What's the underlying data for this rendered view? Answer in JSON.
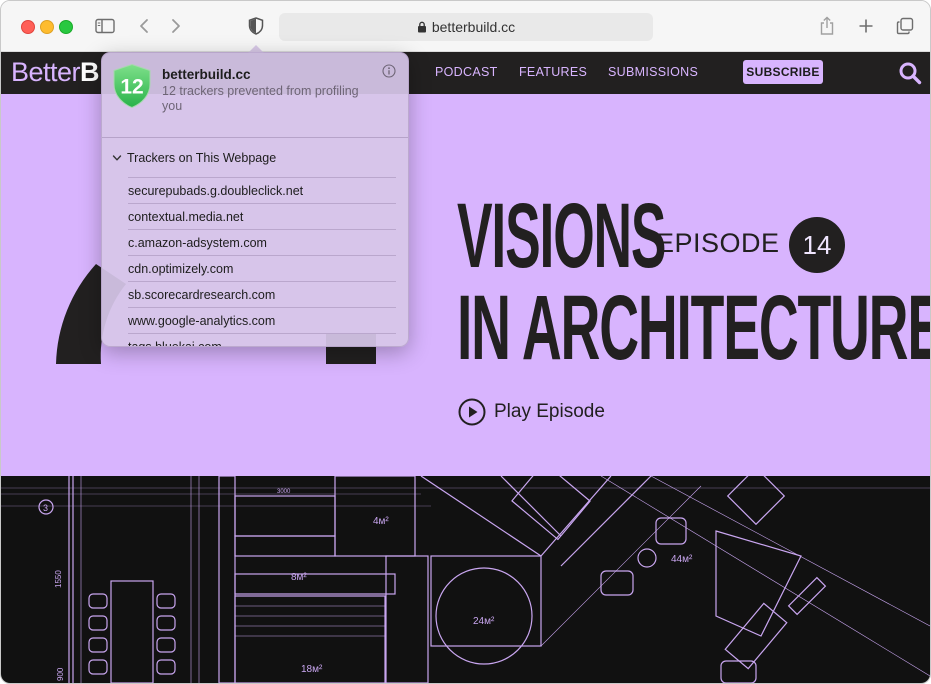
{
  "browser": {
    "url": "betterbuild.cc",
    "icons": [
      "sidebar-icon",
      "back-icon",
      "forward-icon",
      "privacy-shield-icon",
      "lock-icon",
      "share-icon",
      "new-tab-icon",
      "tab-overview-icon"
    ]
  },
  "site": {
    "logo_light": "Better",
    "logo_bold": "B",
    "nav": {
      "podcast": "PODCAST",
      "features": "FEATURES",
      "submissions": "SUBMISSIONS"
    },
    "subscribe": "SUBSCRIBE",
    "colors": {
      "accent": "#d8b4fe",
      "dark": "#222020"
    }
  },
  "hero": {
    "title_line1": "VISIONS",
    "title_line2": "IN ARCHITECTURE",
    "episode_label": "EPISODE",
    "episode_number": "14",
    "play_label": "Play Episode"
  },
  "blueprint": {
    "labels": {
      "grid_3": "3",
      "room_4m": "4м²",
      "room_8m": "8м²",
      "room_24m": "24м²",
      "room_44m": "44м²",
      "room_18m": "18м²",
      "dim_1550": "1550",
      "dim_3000": "3000",
      "dim_900": "900"
    }
  },
  "privacy_report": {
    "tracker_count": "12",
    "site": "betterbuild.cc",
    "message": "12 trackers prevented from profiling you",
    "section_title": "Trackers on This Webpage",
    "trackers": [
      "securepubads.g.doubleclick.net",
      "contextual.media.net",
      "c.amazon-adsystem.com",
      "cdn.optimizely.com",
      "sb.scorecardresearch.com",
      "www.google-analytics.com",
      "tags.bluekai.com"
    ],
    "colors": {
      "shield": "#34c759"
    }
  }
}
